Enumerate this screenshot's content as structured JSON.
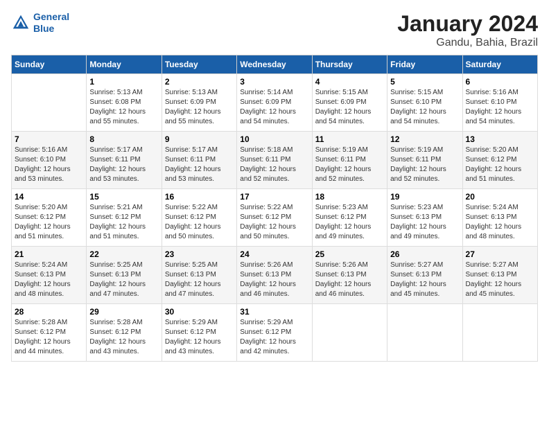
{
  "logo": {
    "line1": "General",
    "line2": "Blue"
  },
  "title": "January 2024",
  "subtitle": "Gandu, Bahia, Brazil",
  "weekdays": [
    "Sunday",
    "Monday",
    "Tuesday",
    "Wednesday",
    "Thursday",
    "Friday",
    "Saturday"
  ],
  "weeks": [
    [
      {
        "day": "",
        "sunrise": "",
        "sunset": "",
        "daylight": ""
      },
      {
        "day": "1",
        "sunrise": "Sunrise: 5:13 AM",
        "sunset": "Sunset: 6:08 PM",
        "daylight": "Daylight: 12 hours and 55 minutes."
      },
      {
        "day": "2",
        "sunrise": "Sunrise: 5:13 AM",
        "sunset": "Sunset: 6:09 PM",
        "daylight": "Daylight: 12 hours and 55 minutes."
      },
      {
        "day": "3",
        "sunrise": "Sunrise: 5:14 AM",
        "sunset": "Sunset: 6:09 PM",
        "daylight": "Daylight: 12 hours and 54 minutes."
      },
      {
        "day": "4",
        "sunrise": "Sunrise: 5:15 AM",
        "sunset": "Sunset: 6:09 PM",
        "daylight": "Daylight: 12 hours and 54 minutes."
      },
      {
        "day": "5",
        "sunrise": "Sunrise: 5:15 AM",
        "sunset": "Sunset: 6:10 PM",
        "daylight": "Daylight: 12 hours and 54 minutes."
      },
      {
        "day": "6",
        "sunrise": "Sunrise: 5:16 AM",
        "sunset": "Sunset: 6:10 PM",
        "daylight": "Daylight: 12 hours and 54 minutes."
      }
    ],
    [
      {
        "day": "7",
        "sunrise": "Sunrise: 5:16 AM",
        "sunset": "Sunset: 6:10 PM",
        "daylight": "Daylight: 12 hours and 53 minutes."
      },
      {
        "day": "8",
        "sunrise": "Sunrise: 5:17 AM",
        "sunset": "Sunset: 6:11 PM",
        "daylight": "Daylight: 12 hours and 53 minutes."
      },
      {
        "day": "9",
        "sunrise": "Sunrise: 5:17 AM",
        "sunset": "Sunset: 6:11 PM",
        "daylight": "Daylight: 12 hours and 53 minutes."
      },
      {
        "day": "10",
        "sunrise": "Sunrise: 5:18 AM",
        "sunset": "Sunset: 6:11 PM",
        "daylight": "Daylight: 12 hours and 52 minutes."
      },
      {
        "day": "11",
        "sunrise": "Sunrise: 5:19 AM",
        "sunset": "Sunset: 6:11 PM",
        "daylight": "Daylight: 12 hours and 52 minutes."
      },
      {
        "day": "12",
        "sunrise": "Sunrise: 5:19 AM",
        "sunset": "Sunset: 6:11 PM",
        "daylight": "Daylight: 12 hours and 52 minutes."
      },
      {
        "day": "13",
        "sunrise": "Sunrise: 5:20 AM",
        "sunset": "Sunset: 6:12 PM",
        "daylight": "Daylight: 12 hours and 51 minutes."
      }
    ],
    [
      {
        "day": "14",
        "sunrise": "Sunrise: 5:20 AM",
        "sunset": "Sunset: 6:12 PM",
        "daylight": "Daylight: 12 hours and 51 minutes."
      },
      {
        "day": "15",
        "sunrise": "Sunrise: 5:21 AM",
        "sunset": "Sunset: 6:12 PM",
        "daylight": "Daylight: 12 hours and 51 minutes."
      },
      {
        "day": "16",
        "sunrise": "Sunrise: 5:22 AM",
        "sunset": "Sunset: 6:12 PM",
        "daylight": "Daylight: 12 hours and 50 minutes."
      },
      {
        "day": "17",
        "sunrise": "Sunrise: 5:22 AM",
        "sunset": "Sunset: 6:12 PM",
        "daylight": "Daylight: 12 hours and 50 minutes."
      },
      {
        "day": "18",
        "sunrise": "Sunrise: 5:23 AM",
        "sunset": "Sunset: 6:12 PM",
        "daylight": "Daylight: 12 hours and 49 minutes."
      },
      {
        "day": "19",
        "sunrise": "Sunrise: 5:23 AM",
        "sunset": "Sunset: 6:13 PM",
        "daylight": "Daylight: 12 hours and 49 minutes."
      },
      {
        "day": "20",
        "sunrise": "Sunrise: 5:24 AM",
        "sunset": "Sunset: 6:13 PM",
        "daylight": "Daylight: 12 hours and 48 minutes."
      }
    ],
    [
      {
        "day": "21",
        "sunrise": "Sunrise: 5:24 AM",
        "sunset": "Sunset: 6:13 PM",
        "daylight": "Daylight: 12 hours and 48 minutes."
      },
      {
        "day": "22",
        "sunrise": "Sunrise: 5:25 AM",
        "sunset": "Sunset: 6:13 PM",
        "daylight": "Daylight: 12 hours and 47 minutes."
      },
      {
        "day": "23",
        "sunrise": "Sunrise: 5:25 AM",
        "sunset": "Sunset: 6:13 PM",
        "daylight": "Daylight: 12 hours and 47 minutes."
      },
      {
        "day": "24",
        "sunrise": "Sunrise: 5:26 AM",
        "sunset": "Sunset: 6:13 PM",
        "daylight": "Daylight: 12 hours and 46 minutes."
      },
      {
        "day": "25",
        "sunrise": "Sunrise: 5:26 AM",
        "sunset": "Sunset: 6:13 PM",
        "daylight": "Daylight: 12 hours and 46 minutes."
      },
      {
        "day": "26",
        "sunrise": "Sunrise: 5:27 AM",
        "sunset": "Sunset: 6:13 PM",
        "daylight": "Daylight: 12 hours and 45 minutes."
      },
      {
        "day": "27",
        "sunrise": "Sunrise: 5:27 AM",
        "sunset": "Sunset: 6:13 PM",
        "daylight": "Daylight: 12 hours and 45 minutes."
      }
    ],
    [
      {
        "day": "28",
        "sunrise": "Sunrise: 5:28 AM",
        "sunset": "Sunset: 6:12 PM",
        "daylight": "Daylight: 12 hours and 44 minutes."
      },
      {
        "day": "29",
        "sunrise": "Sunrise: 5:28 AM",
        "sunset": "Sunset: 6:12 PM",
        "daylight": "Daylight: 12 hours and 43 minutes."
      },
      {
        "day": "30",
        "sunrise": "Sunrise: 5:29 AM",
        "sunset": "Sunset: 6:12 PM",
        "daylight": "Daylight: 12 hours and 43 minutes."
      },
      {
        "day": "31",
        "sunrise": "Sunrise: 5:29 AM",
        "sunset": "Sunset: 6:12 PM",
        "daylight": "Daylight: 12 hours and 42 minutes."
      },
      {
        "day": "",
        "sunrise": "",
        "sunset": "",
        "daylight": ""
      },
      {
        "day": "",
        "sunrise": "",
        "sunset": "",
        "daylight": ""
      },
      {
        "day": "",
        "sunrise": "",
        "sunset": "",
        "daylight": ""
      }
    ]
  ]
}
